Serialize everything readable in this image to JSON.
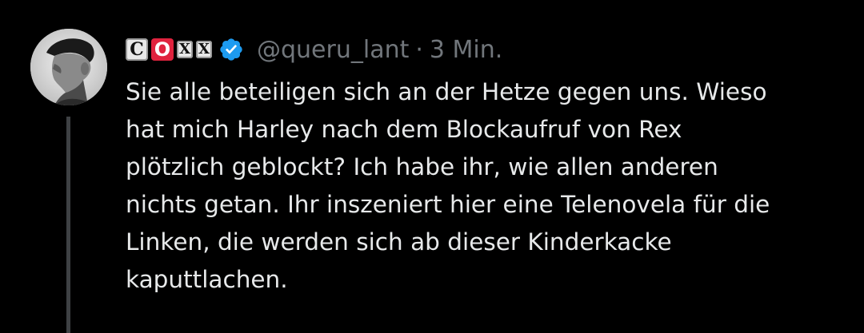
{
  "author": {
    "badges": [
      "C",
      "O",
      "X",
      "X"
    ],
    "verified": true,
    "handle": "@queru_lant",
    "separator": "·",
    "timestamp": "3 Min."
  },
  "tweet": {
    "lines": [
      "Sie alle beteiligen sich an der Hetze gegen uns. Wieso",
      "hat mich Harley nach dem Blockaufruf von Rex",
      "plötzlich geblockt? Ich habe ihr, wie allen anderen",
      "nichts getan. Ihr inszeniert hier eine Telenovela für die",
      "Linken, die werden sich ab dieser Kinderkacke",
      "kaputtlachen."
    ]
  },
  "colors": {
    "background": "#000000",
    "text": "#e7e9ea",
    "muted": "#71767b",
    "verified": "#1d9bf0",
    "badge_red": "#e0233e",
    "thread_line": "#3e4144"
  },
  "icons": {
    "avatar": "avatar-portrait",
    "verified": "verified-badge-icon"
  }
}
